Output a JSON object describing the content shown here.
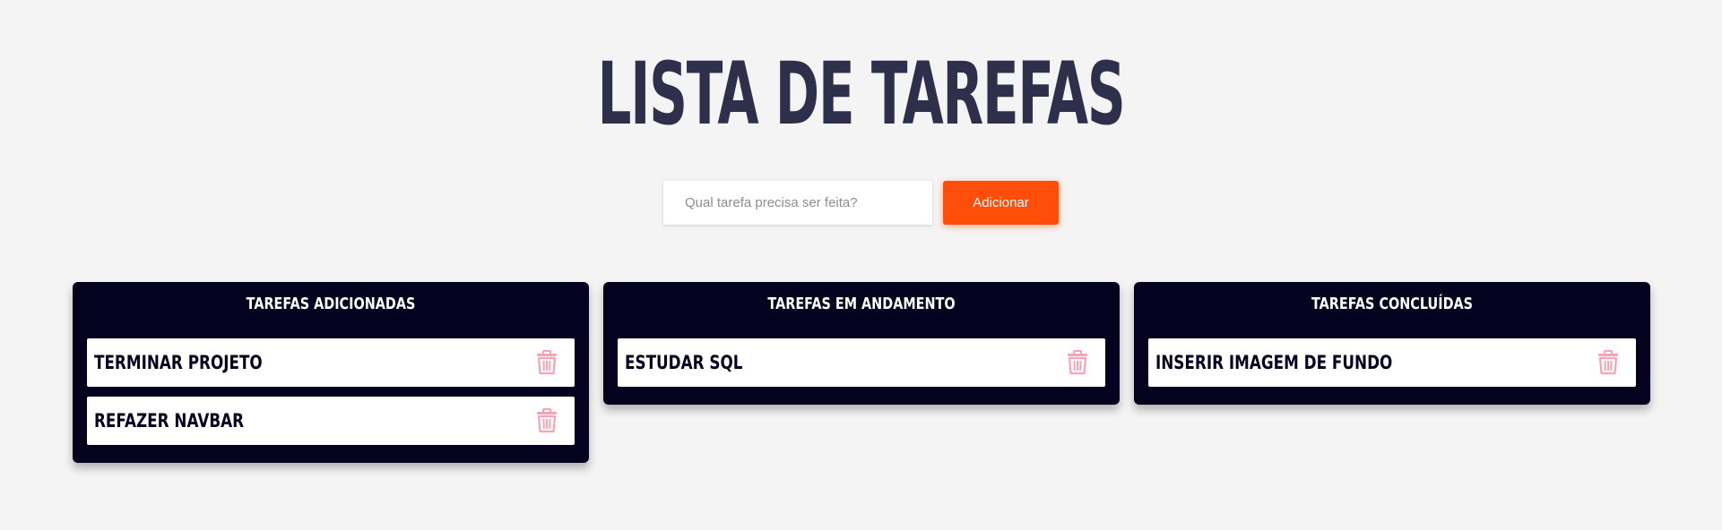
{
  "header": {
    "title": "LISTA DE TAREFAS"
  },
  "form": {
    "placeholder": "Qual tarefa precisa ser feita?",
    "value": "",
    "add_label": "Adicionar"
  },
  "columns": [
    {
      "title": "TAREFAS ADICIONADAS",
      "tasks": [
        {
          "text": "TERMINAR PROJETO",
          "icon": "trash-icon"
        },
        {
          "text": "REFAZER NAVBAR",
          "icon": "trash-icon"
        }
      ]
    },
    {
      "title": "TAREFAS EM ANDAMENTO",
      "tasks": [
        {
          "text": "ESTUDAR SQL",
          "icon": "trash-icon"
        }
      ]
    },
    {
      "title": "TAREFAS CONCLUÍDAS",
      "tasks": [
        {
          "text": "INSERIR IMAGEM DE FUNDO",
          "icon": "trash-icon"
        }
      ]
    }
  ],
  "colors": {
    "background": "#f4f4f4",
    "title": "#2e2f4a",
    "accent": "#ff4d0a",
    "column_background": "#03021f",
    "trash": "#f7a3b5"
  }
}
